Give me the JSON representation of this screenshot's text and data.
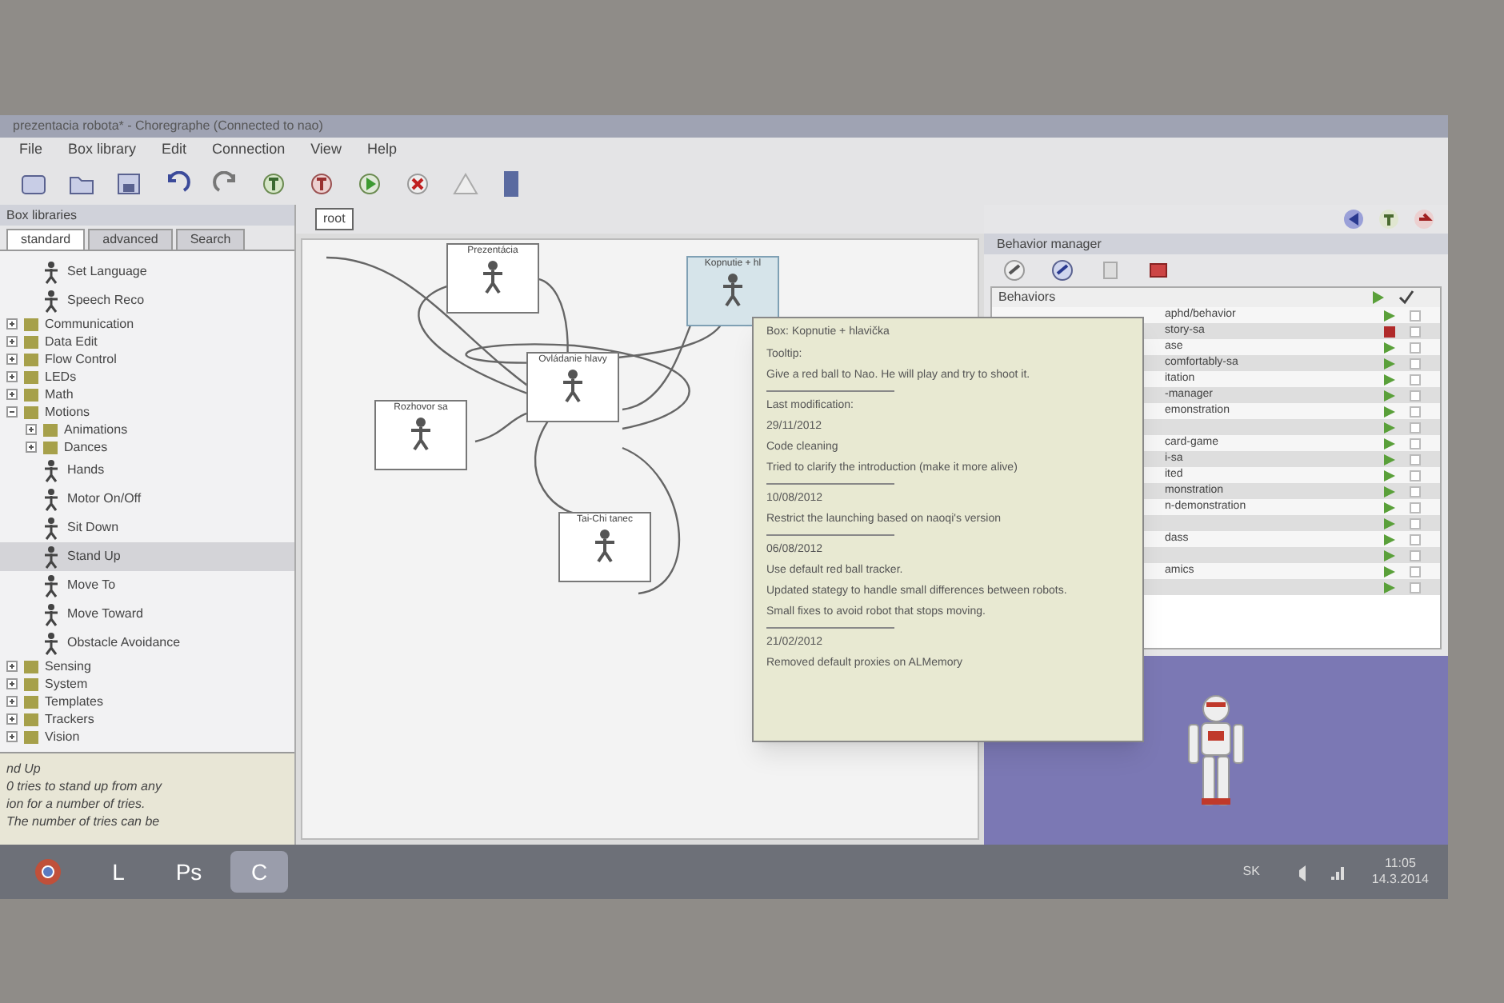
{
  "window": {
    "title": "prezentacia robota* - Choregraphe (Connected to nao)"
  },
  "menu": [
    "File",
    "Box library",
    "Edit",
    "Connection",
    "View",
    "Help"
  ],
  "box_libraries": {
    "title": "Box libraries",
    "tabs": [
      {
        "label": "standard",
        "selected": true
      },
      {
        "label": "advanced",
        "selected": false
      },
      {
        "label": "Search",
        "selected": false
      }
    ],
    "tree": [
      {
        "kind": "continuation",
        "children": [
          {
            "label": "Set Language",
            "kind": "box",
            "selected": false
          },
          {
            "label": "Speech Reco",
            "kind": "box",
            "selected": false
          }
        ]
      },
      {
        "label": "Communication",
        "kind": "folder",
        "expanded": false
      },
      {
        "label": "Data Edit",
        "kind": "folder",
        "expanded": false
      },
      {
        "label": "Flow Control",
        "kind": "folder",
        "expanded": false
      },
      {
        "label": "LEDs",
        "kind": "folder",
        "expanded": false
      },
      {
        "label": "Math",
        "kind": "folder",
        "expanded": false
      },
      {
        "label": "Motions",
        "kind": "folder",
        "expanded": true,
        "children": [
          {
            "label": "Animations",
            "kind": "folder",
            "expanded": false
          },
          {
            "label": "Dances",
            "kind": "folder",
            "expanded": false
          },
          {
            "label": "Hands",
            "kind": "box",
            "selected": false
          },
          {
            "label": "Motor On/Off",
            "kind": "box",
            "selected": false
          },
          {
            "label": "Sit Down",
            "kind": "box",
            "selected": false
          },
          {
            "label": "Stand Up",
            "kind": "box",
            "selected": true
          },
          {
            "label": "Move To",
            "kind": "box",
            "selected": false
          },
          {
            "label": "Move Toward",
            "kind": "box",
            "selected": false
          },
          {
            "label": "Obstacle Avoidance",
            "kind": "box",
            "selected": false
          }
        ]
      },
      {
        "label": "Sensing",
        "kind": "folder",
        "expanded": false
      },
      {
        "label": "System",
        "kind": "folder",
        "expanded": false
      },
      {
        "label": "Templates",
        "kind": "folder",
        "expanded": false
      },
      {
        "label": "Trackers",
        "kind": "folder",
        "expanded": false
      },
      {
        "label": "Vision",
        "kind": "folder",
        "expanded": false
      }
    ],
    "description": [
      "nd Up",
      "0 tries to stand up from any",
      "ion for a number of tries.",
      "The number of tries can be"
    ]
  },
  "breadcrumb": {
    "label": "root"
  },
  "diagram": {
    "boxes": [
      {
        "title": "Prezentácia",
        "selected": false
      },
      {
        "title": "Kopnutie + hl",
        "selected": true
      },
      {
        "title": "Ovládanie hlavy",
        "selected": false
      },
      {
        "title": "Rozhovor sa",
        "selected": false
      },
      {
        "title": "Tai-Chi tanec",
        "selected": false
      }
    ],
    "tooltip": {
      "title": "Box: Kopnutie + hlavička",
      "lines": [
        {
          "kind": "text",
          "text": "Tooltip:"
        },
        {
          "kind": "text",
          "text": "Give a red ball to Nao. He will play and try to shoot it."
        },
        {
          "kind": "rule"
        },
        {
          "kind": "text",
          "text": "Last modification:"
        },
        {
          "kind": "text",
          "text": "29/11/2012"
        },
        {
          "kind": "text",
          "text": "Code cleaning"
        },
        {
          "kind": "text",
          "text": "Tried to clarify the introduction (make it more alive)"
        },
        {
          "kind": "rule"
        },
        {
          "kind": "text",
          "text": "10/08/2012"
        },
        {
          "kind": "text",
          "text": "Restrict the launching based on naoqi's version"
        },
        {
          "kind": "rule"
        },
        {
          "kind": "text",
          "text": "06/08/2012"
        },
        {
          "kind": "text",
          "text": "Use default red ball tracker."
        },
        {
          "kind": "text",
          "text": "Updated stategy to handle small differences between robots."
        },
        {
          "kind": "text",
          "text": "Small fixes to avoid robot that stops moving."
        },
        {
          "kind": "rule"
        },
        {
          "kind": "text",
          "text": "21/02/2012"
        },
        {
          "kind": "text",
          "text": "Removed default proxies on ALMemory"
        }
      ]
    }
  },
  "behavior_manager": {
    "title": "Behavior manager",
    "list_title": "Behaviors",
    "rows": [
      {
        "label": "aphd/behavior",
        "running": false,
        "checked": false
      },
      {
        "label": "story-sa",
        "running": true,
        "checked": false
      },
      {
        "label": "ase",
        "running": false,
        "checked": false
      },
      {
        "label": "comfortably-sa",
        "running": false,
        "checked": false
      },
      {
        "label": "itation",
        "running": false,
        "checked": false
      },
      {
        "label": "-manager",
        "running": false,
        "checked": false
      },
      {
        "label": "emonstration",
        "running": false,
        "checked": false
      },
      {
        "running": false,
        "checked": false
      },
      {
        "label": "card-game",
        "running": false,
        "checked": false
      },
      {
        "label": "i-sa",
        "running": false,
        "checked": false
      },
      {
        "label": "ited",
        "running": false,
        "checked": false
      },
      {
        "label": "monstration",
        "running": false,
        "checked": false
      },
      {
        "label": "n-demonstration",
        "running": false,
        "checked": false
      },
      {
        "running": false,
        "checked": false
      },
      {
        "label": "dass",
        "running": false,
        "checked": false
      },
      {
        "running": false,
        "checked": false
      },
      {
        "label": "amics",
        "running": false,
        "checked": false
      },
      {
        "running": false,
        "checked": false
      }
    ]
  },
  "taskbar": {
    "apps": [
      {
        "kind": "browser",
        "selected": false
      },
      {
        "kind": "letter",
        "label": "L",
        "selected": false
      },
      {
        "kind": "letter",
        "label": "Ps",
        "selected": false
      },
      {
        "kind": "letter",
        "label": "C",
        "selected": true
      }
    ],
    "tray": {
      "language": "SK",
      "time": "11:05",
      "date": "14.3.2014"
    }
  }
}
